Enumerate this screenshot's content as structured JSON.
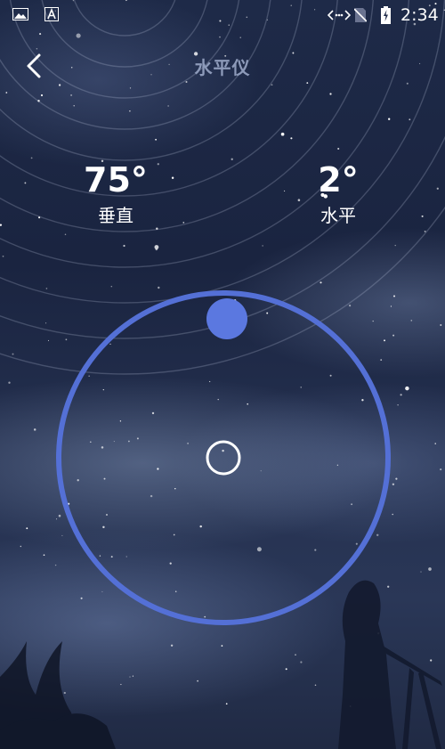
{
  "status_bar": {
    "time": "2:34",
    "icons": [
      "gallery-icon",
      "text-a-icon",
      "data-transfer-icon",
      "no-sim-icon",
      "battery-charging-icon"
    ]
  },
  "header": {
    "title": "水平仪",
    "back_icon": "chevron-left-icon"
  },
  "readouts": {
    "vertical": {
      "value": "75°",
      "label": "垂直"
    },
    "horizontal": {
      "value": "2°",
      "label": "水平"
    }
  },
  "level": {
    "ring_color": "#5470d6",
    "bubble_color": "#5b78e0",
    "center_marker_color": "#ffffff"
  }
}
